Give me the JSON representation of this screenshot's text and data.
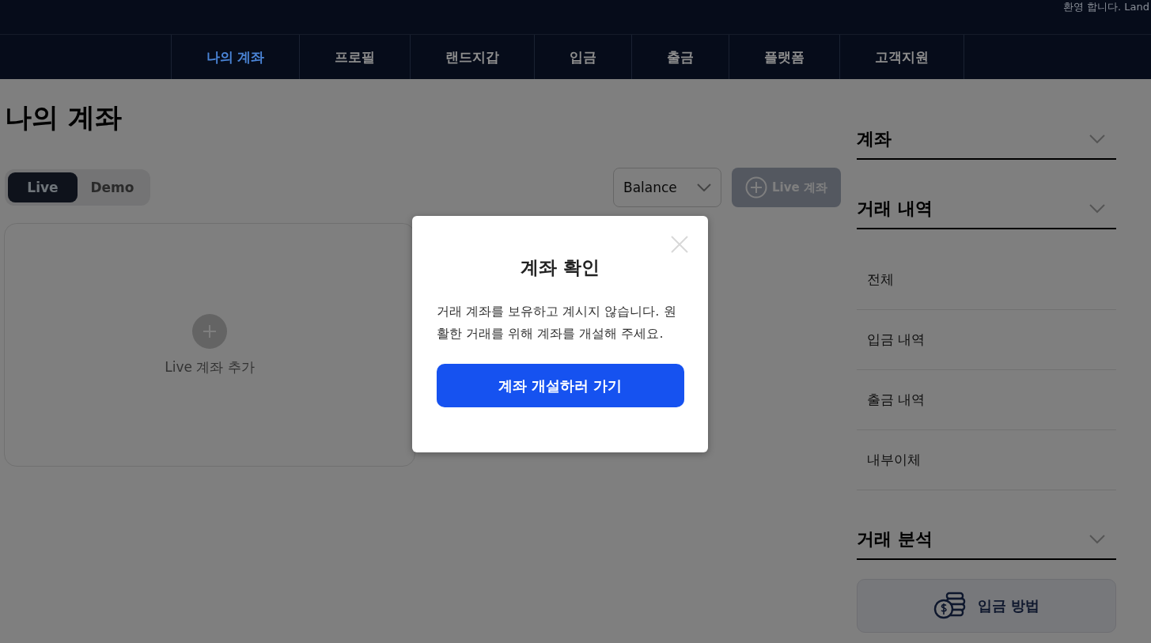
{
  "header": {
    "welcome": "환영 합니다. Land"
  },
  "nav": [
    {
      "label": "나의 계좌",
      "selected": true
    },
    {
      "label": "프로필",
      "selected": false
    },
    {
      "label": "랜드지갑",
      "selected": false
    },
    {
      "label": "입금",
      "selected": false
    },
    {
      "label": "출금",
      "selected": false
    },
    {
      "label": "플랫폼",
      "selected": false
    },
    {
      "label": "고객지원",
      "selected": false
    }
  ],
  "page_title": "나의 계좌",
  "account_tabs": [
    {
      "label": "Live",
      "selected": true
    },
    {
      "label": "Demo",
      "selected": false
    }
  ],
  "sort_select": {
    "value": "Balance"
  },
  "add_account_button": {
    "label": "Live 계좌"
  },
  "add_card": {
    "label": "Live 계좌 추가"
  },
  "sidebar": {
    "sections": [
      {
        "title": "계좌"
      },
      {
        "title": "거래 내역",
        "items": [
          "전체",
          "입금 내역",
          "출금 내역",
          "내부이체"
        ]
      },
      {
        "title": "거래 분석"
      }
    ],
    "guide_button": {
      "label": "입금 방법"
    }
  },
  "modal": {
    "title": "계좌 확인",
    "message": "거래 계좌를 보유하고 계시지 않습니다. 원활한 거래를 위해 계좌를 개설해 주세요.",
    "action": "계좌 개설하러 가기"
  }
}
